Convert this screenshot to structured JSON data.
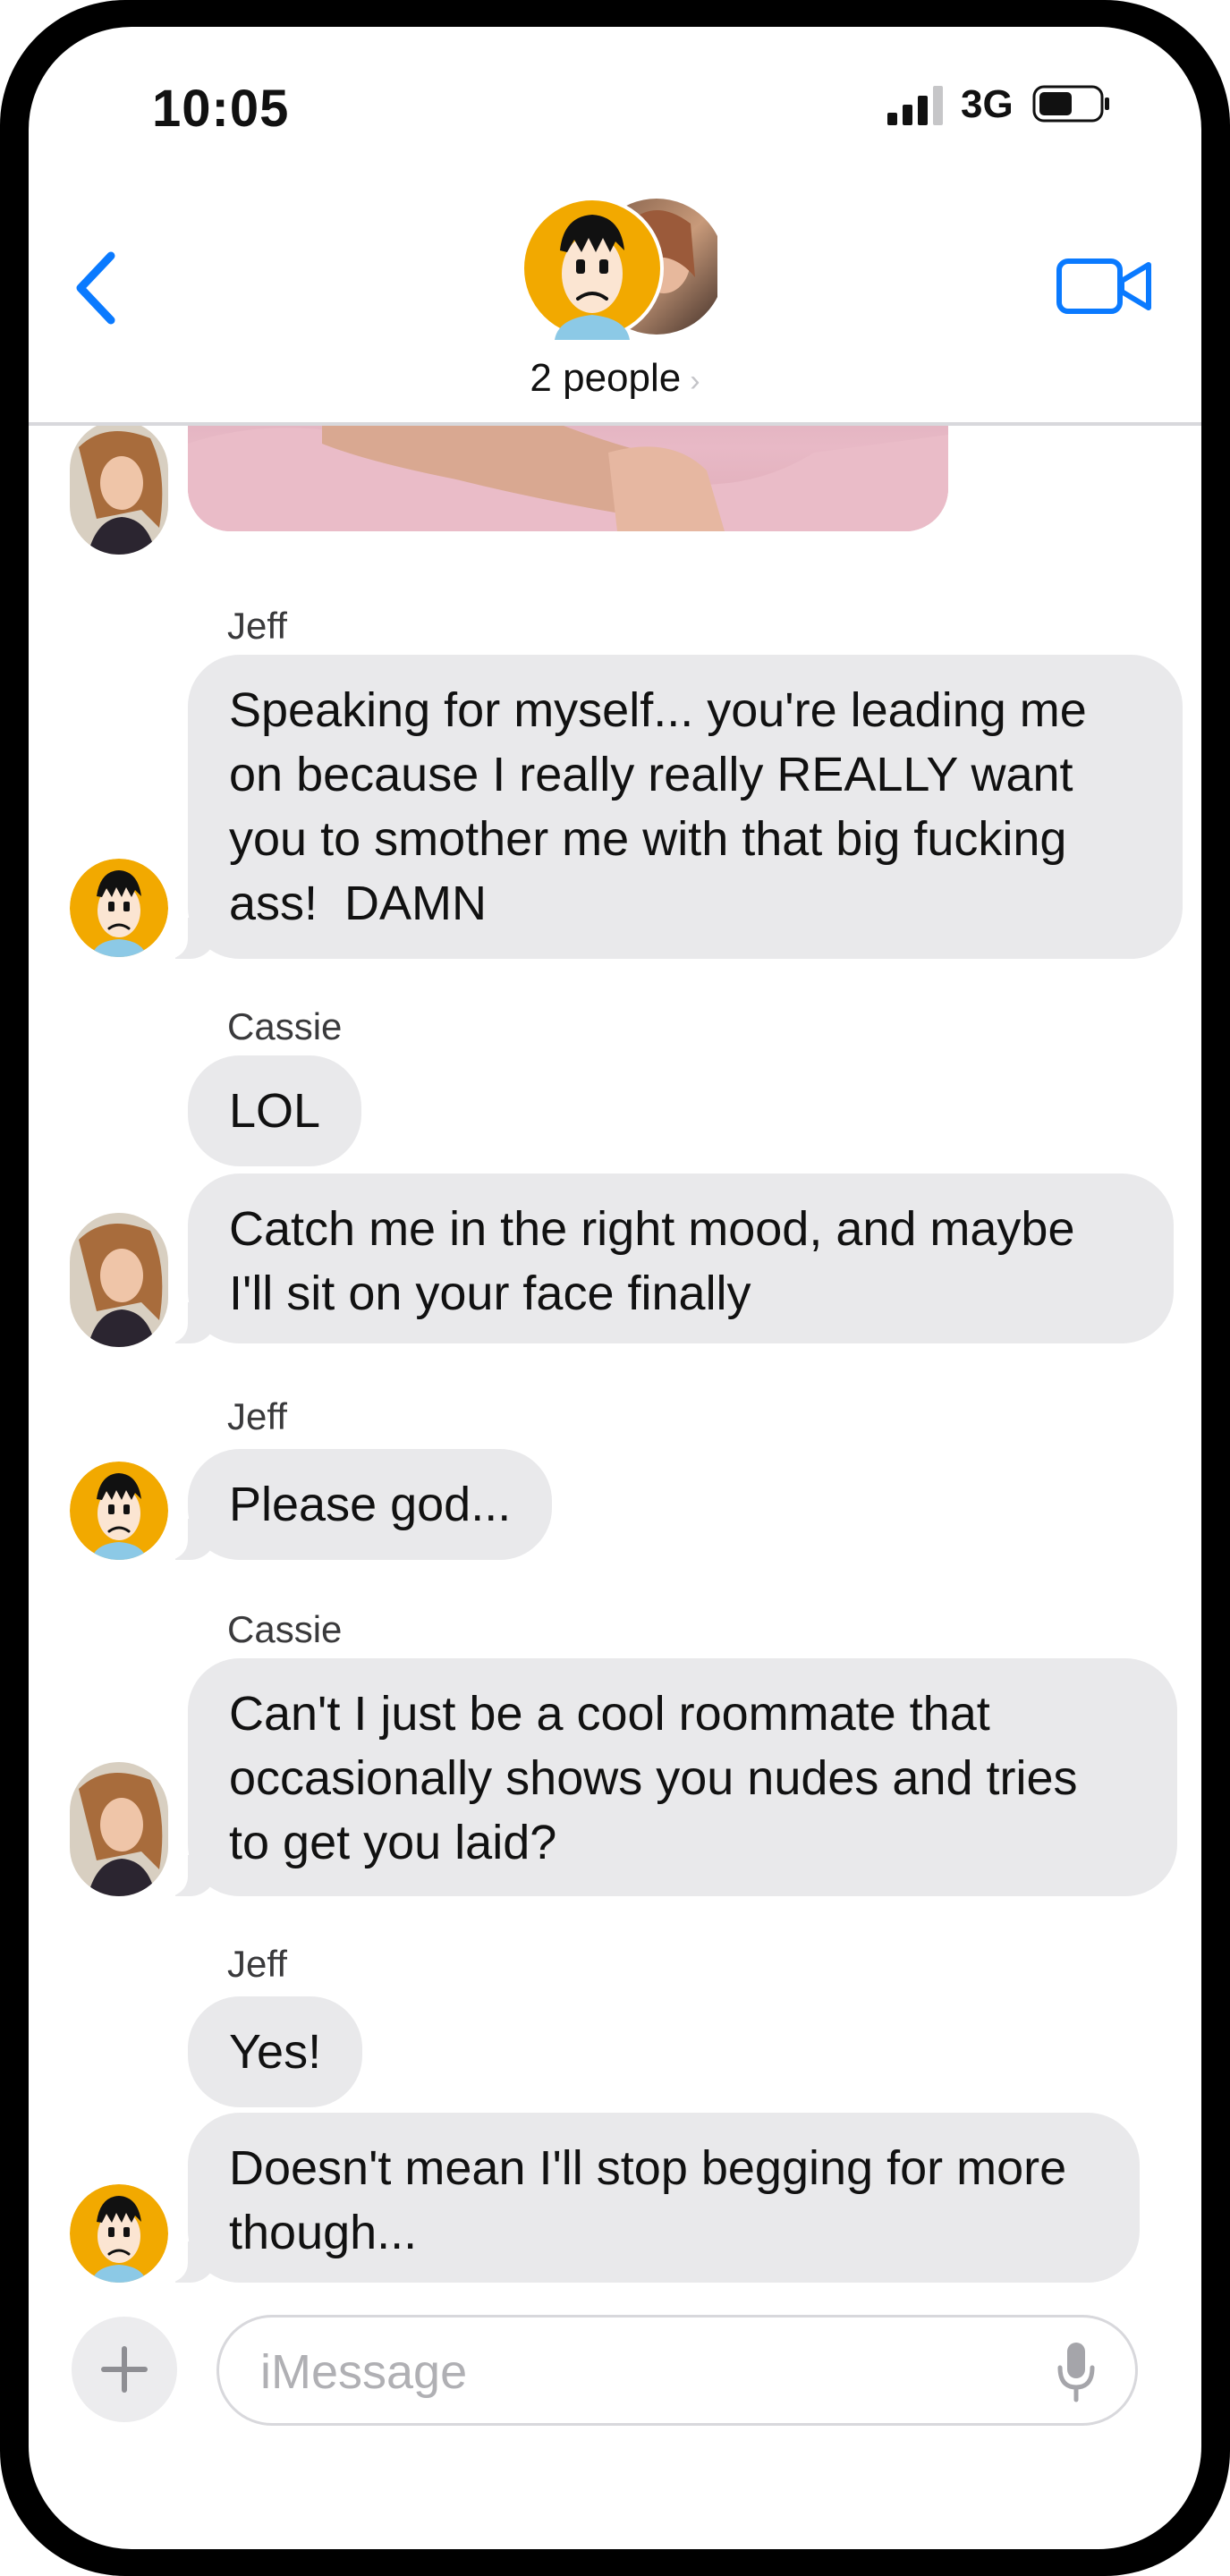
{
  "status_bar": {
    "time": "10:05",
    "network": "3G",
    "signal_bars": 3,
    "icons": [
      "signal-icon",
      "battery-icon"
    ]
  },
  "nav": {
    "group_title": "2 people",
    "chevron": "›",
    "icons": [
      "back-chevron-icon",
      "video-call-icon"
    ]
  },
  "thread": {
    "messages": [
      {
        "sender": "Jeff",
        "text": "Speaking for myself... you're leading me\non because I really really REALLY want\nyou to smother me with that big fucking\nass!  DAMN"
      },
      {
        "sender": "Cassie",
        "text": "LOL"
      },
      {
        "sender": "",
        "text": "Catch me in the right mood, and maybe\nI'll sit on your face finally"
      },
      {
        "sender": "Jeff",
        "text": "Please god..."
      },
      {
        "sender": "Cassie",
        "text": "Can't I just be a cool roommate that\noccasionally shows you nudes and tries\nto get you laid?"
      },
      {
        "sender": "Jeff",
        "text": "Yes!"
      },
      {
        "sender": "",
        "text": "Doesn't mean I'll stop begging for more\nthough..."
      }
    ]
  },
  "input_bar": {
    "placeholder": "iMessage",
    "icons": [
      "plus-icon",
      "microphone-icon"
    ]
  },
  "colors": {
    "accent": "#0A7AFF",
    "bubble_gray": "#E9E9EB",
    "jeff_avatar_bg": "#F2A900"
  }
}
